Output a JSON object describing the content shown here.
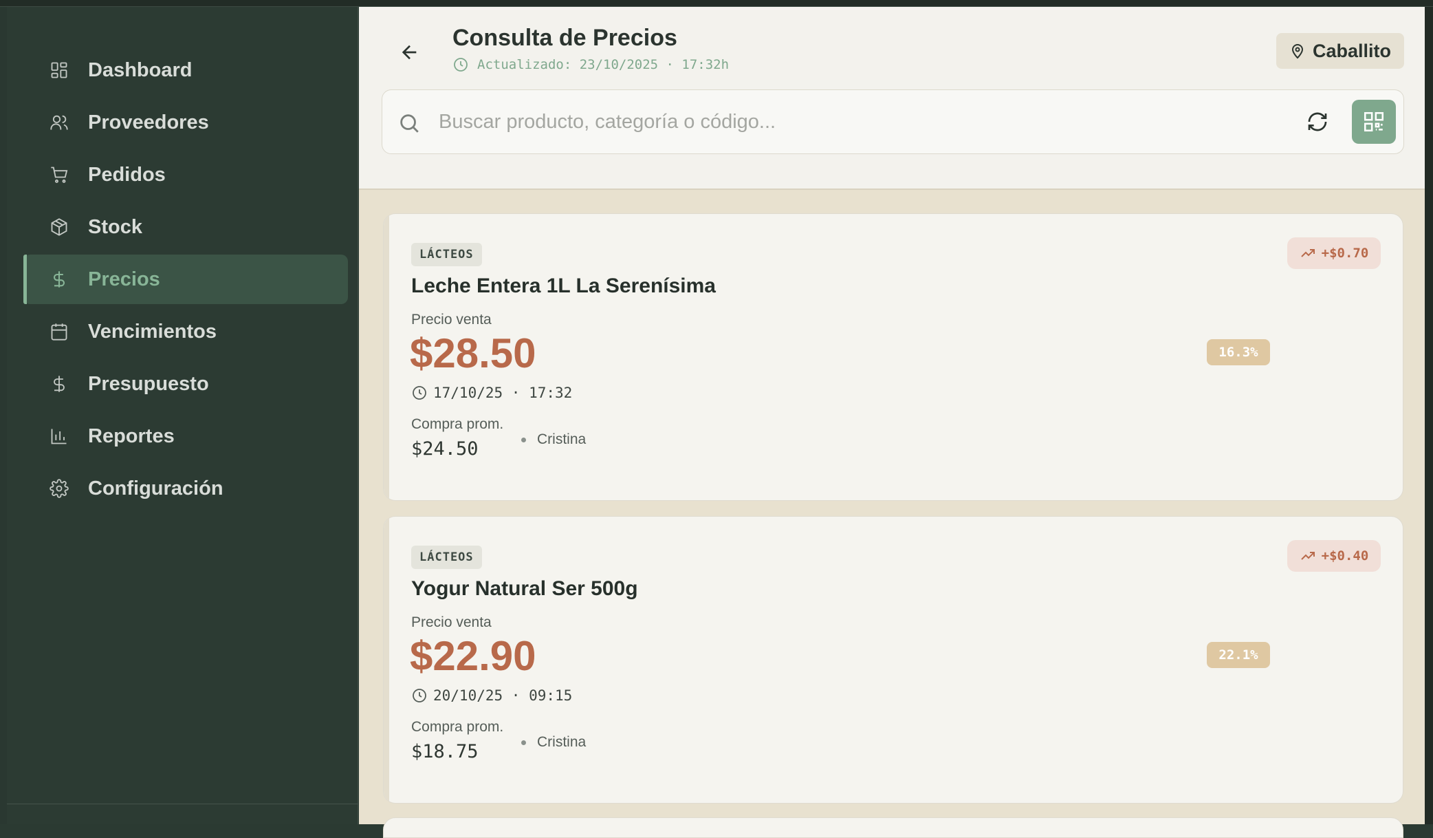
{
  "sidebar": {
    "items": [
      {
        "label": "Dashboard",
        "icon": "dashboard-icon",
        "active": false
      },
      {
        "label": "Proveedores",
        "icon": "users-icon",
        "active": false
      },
      {
        "label": "Pedidos",
        "icon": "cart-icon",
        "active": false
      },
      {
        "label": "Stock",
        "icon": "box-icon",
        "active": false
      },
      {
        "label": "Precios",
        "icon": "dollar-icon",
        "active": true
      },
      {
        "label": "Vencimientos",
        "icon": "calendar-icon",
        "active": false
      },
      {
        "label": "Presupuesto",
        "icon": "dollar-icon",
        "active": false
      },
      {
        "label": "Reportes",
        "icon": "bar-chart-icon",
        "active": false
      },
      {
        "label": "Configuración",
        "icon": "gear-icon",
        "active": false
      }
    ]
  },
  "header": {
    "title": "Consulta de Precios",
    "updated": "Actualizado: 23/10/2025 · 17:32h",
    "location": "Caballito"
  },
  "search": {
    "placeholder": "Buscar producto, categoría o código...",
    "value": ""
  },
  "products": [
    {
      "category": "LÁCTEOS",
      "name": "Leche Entera 1L La Serenísima",
      "price_label": "Precio venta",
      "price": "$28.50",
      "date": "17/10/25 · 17:32",
      "purchase_label": "Compra prom.",
      "purchase": "$24.50",
      "supplier": "Cristina",
      "margin": "16.3%",
      "change": "+$0.70"
    },
    {
      "category": "LÁCTEOS",
      "name": "Yogur Natural Ser 500g",
      "price_label": "Precio venta",
      "price": "$22.90",
      "date": "20/10/25 · 09:15",
      "purchase_label": "Compra prom.",
      "purchase": "$18.75",
      "supplier": "Cristina",
      "margin": "22.1%",
      "change": "+$0.40"
    }
  ],
  "colors": {
    "sidebar_bg": "#2c3b33",
    "accent": "#7fa88d",
    "price": "#b8694a",
    "main_bg": "#e8e1cf"
  }
}
